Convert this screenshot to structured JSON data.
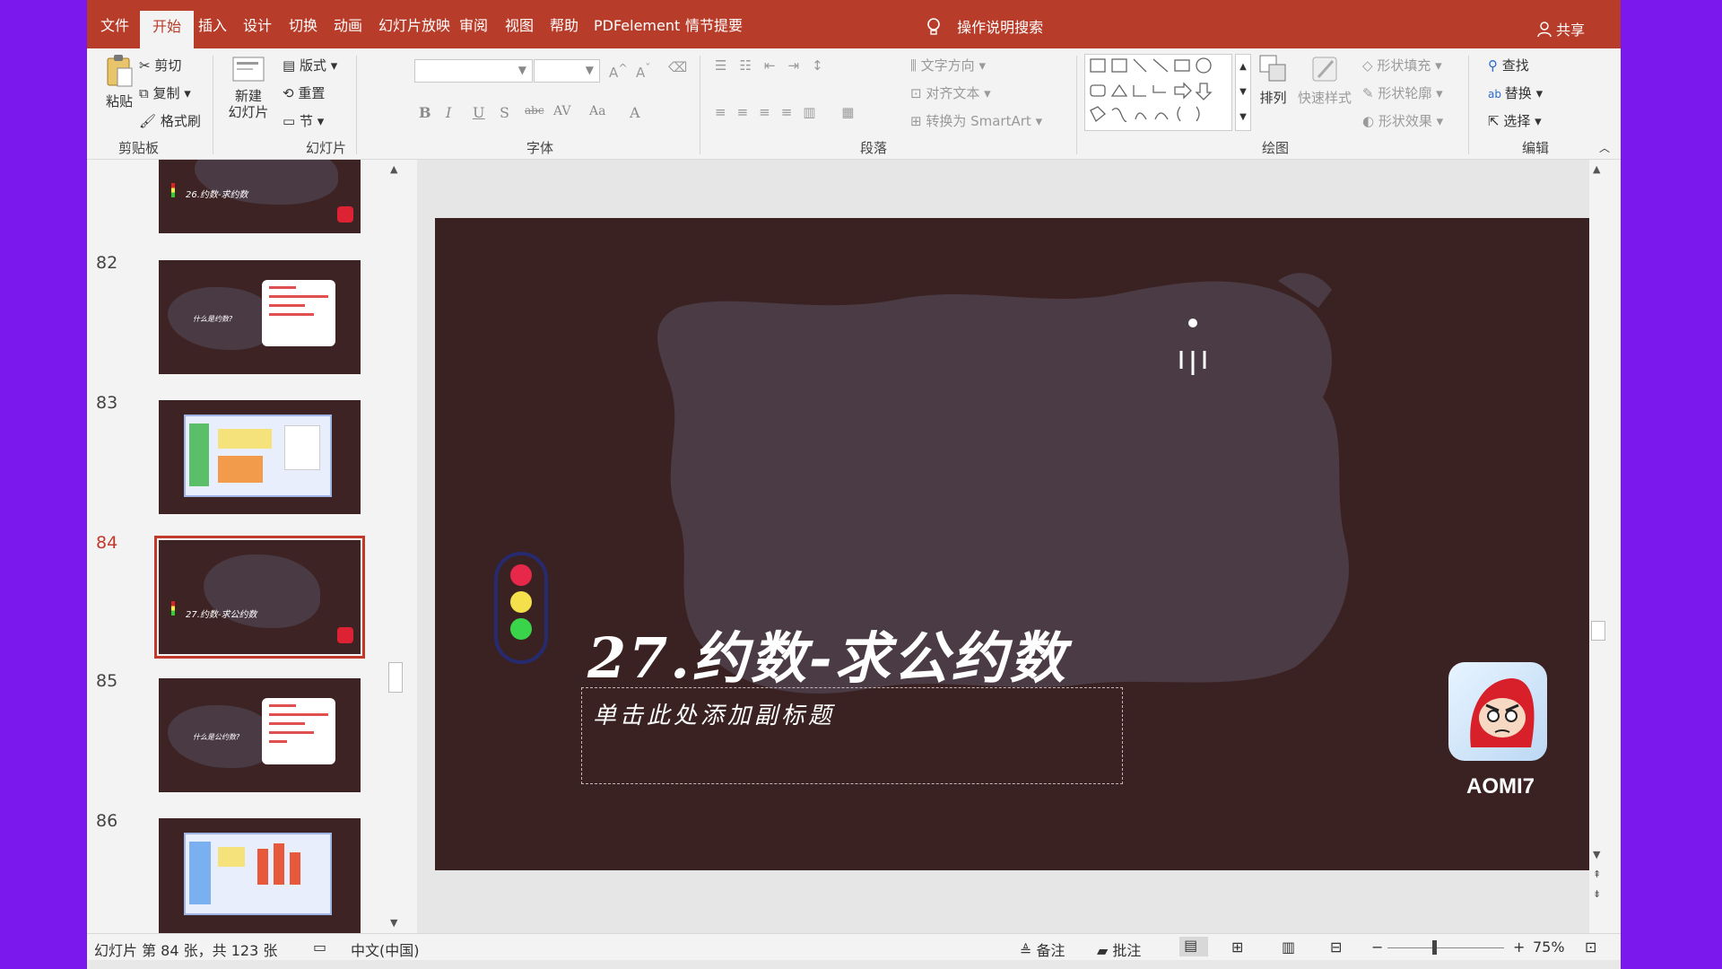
{
  "ribbon_tabs": [
    "文件",
    "开始",
    "插入",
    "设计",
    "切换",
    "动画",
    "幻灯片放映",
    "审阅",
    "视图",
    "帮助",
    "PDFelement",
    "情节提要"
  ],
  "active_tab": "开始",
  "search_label": "操作说明搜索",
  "share_label": "共享",
  "clipboard": {
    "paste": "粘贴",
    "cut": "剪切",
    "copy": "复制",
    "format_painter": "格式刷",
    "label": "剪贴板"
  },
  "slides_group": {
    "new_slide": "新建\n幻灯片",
    "layout": "版式",
    "reset": "重置",
    "section": "节",
    "label": "幻灯片"
  },
  "font_group": {
    "label": "字体",
    "buttons": [
      "B",
      "I",
      "U",
      "S",
      "abc",
      "AV",
      "Aa",
      "A"
    ]
  },
  "paragraph_group": {
    "label": "段落",
    "text_direction": "文字方向",
    "align_text": "对齐文本",
    "convert_smartart": "转换为 SmartArt"
  },
  "drawing_group": {
    "label": "绘图",
    "arrange": "排列",
    "quick_styles": "快速样式",
    "shape_fill": "形状填充",
    "shape_outline": "形状轮廓",
    "shape_effects": "形状效果"
  },
  "editing_group": {
    "label": "编辑",
    "find": "查找",
    "replace": "替换",
    "select": "选择"
  },
  "thumbnails": [
    {
      "num": "",
      "title": "26.约数-求约数",
      "kind": "title"
    },
    {
      "num": "82",
      "title": "什么是约数?",
      "kind": "card"
    },
    {
      "num": "83",
      "title": "",
      "kind": "shot"
    },
    {
      "num": "84",
      "title": "27.约数-求公约数",
      "kind": "title",
      "selected": true
    },
    {
      "num": "85",
      "title": "什么是公约数?",
      "kind": "card"
    },
    {
      "num": "86",
      "title": "",
      "kind": "shot"
    }
  ],
  "slide": {
    "title": "27.约数-求公约数",
    "subtitle_placeholder": "单击此处添加副标题",
    "logo_text": "AOMI7",
    "traffic_light_colors": [
      "#e8284a",
      "#f4e04a",
      "#3ad44a"
    ]
  },
  "status": {
    "slide_info": "幻灯片 第 84 张，共 123 张",
    "language": "中文(中国)",
    "notes": "备注",
    "comments": "批注",
    "zoom": "75%"
  },
  "colors": {
    "accent": "#b83c2a",
    "slide_bg": "#3b2222",
    "blob": "#4a3b45",
    "outer_bg": "#7a18ee"
  }
}
